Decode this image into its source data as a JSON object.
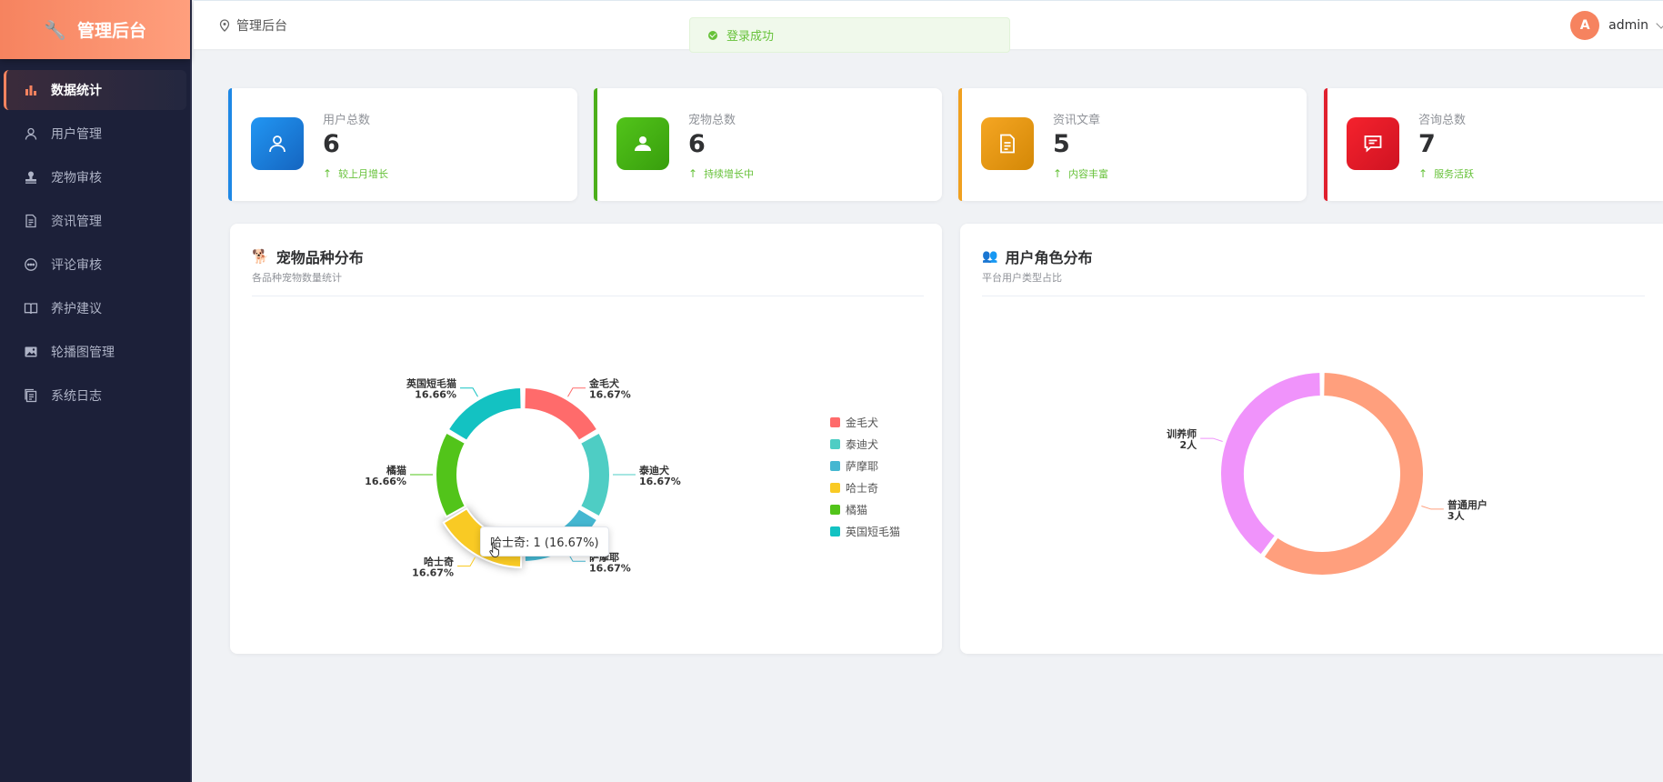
{
  "sidebar": {
    "title": "管理后台",
    "items": [
      {
        "label": "数据统计",
        "icon": "bar-chart-icon",
        "active": true
      },
      {
        "label": "用户管理",
        "icon": "user-icon"
      },
      {
        "label": "宠物审核",
        "icon": "stamp-icon"
      },
      {
        "label": "资讯管理",
        "icon": "document-icon"
      },
      {
        "label": "评论审核",
        "icon": "comment-icon"
      },
      {
        "label": "养护建议",
        "icon": "book-icon"
      },
      {
        "label": "轮播图管理",
        "icon": "image-icon"
      },
      {
        "label": "系统日志",
        "icon": "log-icon"
      }
    ]
  },
  "header": {
    "breadcrumb": "管理后台",
    "user": {
      "avatar_letter": "A",
      "name": "admin"
    }
  },
  "toast": {
    "message": "登录成功",
    "type": "success"
  },
  "stats": [
    {
      "label": "用户总数",
      "value": "6",
      "trend": "较上月增长",
      "color": "#1e88e5",
      "icon": "user-icon"
    },
    {
      "label": "宠物总数",
      "value": "6",
      "trend": "持续增长中",
      "color": "#4caf1a",
      "icon": "person-card-icon"
    },
    {
      "label": "资讯文章",
      "value": "5",
      "trend": "内容丰富",
      "color": "#f0a020",
      "icon": "document-icon"
    },
    {
      "label": "咨询总数",
      "value": "7",
      "trend": "服务活跃",
      "color": "#e0202e",
      "icon": "chat-icon"
    }
  ],
  "charts": {
    "pet": {
      "title": "宠物品种分布",
      "subtitle": "各品种宠物数量统计",
      "icon": "pet-icon"
    },
    "role": {
      "title": "用户角色分布",
      "subtitle": "平台用户类型占比",
      "icon": "users-icon"
    }
  },
  "chart_data": [
    {
      "type": "pie",
      "variant": "donut",
      "title": "宠物品种分布",
      "subtitle": "各品种宠物数量统计",
      "legend_position": "right",
      "categories": [
        "金毛犬",
        "泰迪犬",
        "萨摩耶",
        "哈士奇",
        "橘猫",
        "英国短毛猫"
      ],
      "values": [
        1,
        1,
        1,
        1,
        1,
        1
      ],
      "labels": [
        "16.67%",
        "16.67%",
        "16.67%",
        "16.67%",
        "16.66%",
        "16.66%"
      ],
      "colors": [
        "#ff6b6b",
        "#4ecdc4",
        "#45b7d1",
        "#f9ca24",
        "#52c41a",
        "#13c2c2"
      ],
      "tooltip": "哈士奇: 1 (16.67%)",
      "highlighted": "哈士奇"
    },
    {
      "type": "pie",
      "variant": "donut",
      "title": "用户角色分布",
      "subtitle": "平台用户类型占比",
      "categories": [
        "普通用户",
        "训养师"
      ],
      "values": [
        3,
        2
      ],
      "labels": [
        "3人",
        "2人"
      ],
      "colors": [
        "#ff9f7d",
        "#f093fb"
      ]
    }
  ]
}
